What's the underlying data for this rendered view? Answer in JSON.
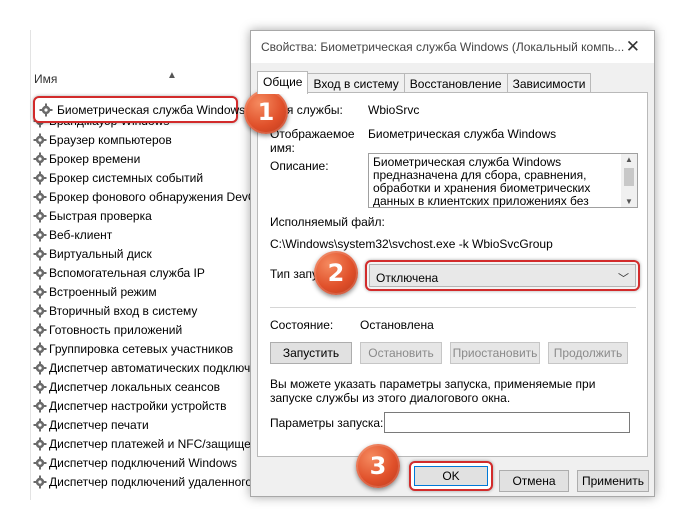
{
  "services_list": {
    "column_header": "Имя",
    "selected_item": "Биометрическая служба Windows",
    "items": [
      "Брандмауэр Windows",
      "Браузер компьютеров",
      "Брокер времени",
      "Брокер системных событий",
      "Брокер фонового обнаружения DevQ",
      "Быстрая проверка",
      "Веб-клиент",
      "Виртуальный диск",
      "Вспомогательная служба IP",
      "Встроенный режим",
      "Вторичный вход в систему",
      "Готовность приложений",
      "Группировка сетевых участников",
      "Диспетчер автоматических подключ",
      "Диспетчер локальных сеансов",
      "Диспетчер настройки устройств",
      "Диспетчер печати",
      "Диспетчер платежей и NFC/защищен",
      "Диспетчер подключений Windows",
      "Диспетчер подключений удаленного"
    ]
  },
  "dialog": {
    "title": "Свойства: Биометрическая служба Windows (Локальный компь...",
    "close_glyph": "✕",
    "tabs": [
      "Общие",
      "Вход в систему",
      "Восстановление",
      "Зависимости"
    ],
    "service_name_label": "Имя службы:",
    "service_name_value": "WbioSrvc",
    "display_name_label": "Отображаемое имя:",
    "display_name_value": "Биометрическая служба Windows",
    "description_label": "Описание:",
    "description_value": "Биометрическая служба Windows предназначена для сбора, сравнения, обработки и хранения биометрических данных в клиентских приложениях без получения",
    "executable_label": "Исполняемый файл:",
    "executable_value": "C:\\Windows\\system32\\svchost.exe -k WbioSvcGroup",
    "startup_type_label": "Тип запуска:",
    "startup_type_value": "Отключена",
    "status_label": "Состояние:",
    "status_value": "Остановлена",
    "buttons": {
      "start": "Запустить",
      "stop": "Остановить",
      "pause": "Приостановить",
      "resume": "Продолжить"
    },
    "hint_text": "Вы можете указать параметры запуска, применяемые при запуске службы из этого диалогового окна.",
    "params_label": "Параметры запуска:",
    "params_value": "",
    "ok": "OK",
    "cancel": "Отмена",
    "apply": "Применить"
  },
  "steps": [
    "1",
    "2",
    "3"
  ],
  "colors": {
    "highlight": "#d22b2b",
    "step_marker": "#e0502a",
    "focus": "#0078d7"
  }
}
